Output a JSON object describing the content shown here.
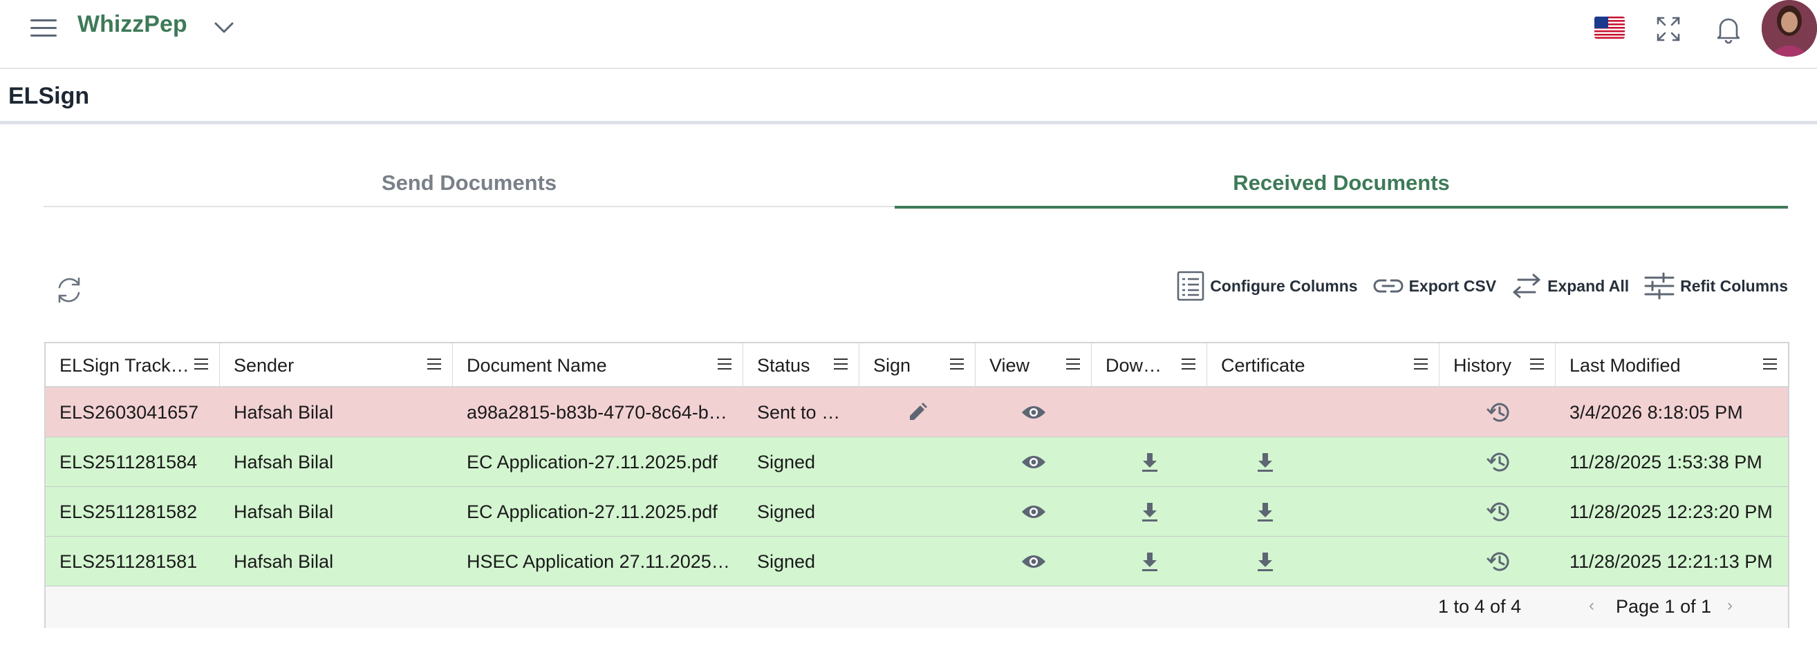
{
  "app": {
    "brand": "WhizzPep"
  },
  "page": {
    "title": "ELSign"
  },
  "tabs": [
    {
      "label": "Send Documents",
      "active": false
    },
    {
      "label": "Received Documents",
      "active": true
    }
  ],
  "toolbar": {
    "configure_columns": "Configure Columns",
    "export_csv": "Export CSV",
    "expand_all": "Expand All",
    "refit_columns": "Refit Columns"
  },
  "grid": {
    "columns": [
      "ELSign Track…",
      "Sender",
      "Document Name",
      "Status",
      "Sign",
      "View",
      "Dow…",
      "Certificate",
      "History",
      "Last Modified"
    ],
    "rows": [
      {
        "tracking": "ELS2603041657",
        "sender": "Hafsah Bilal",
        "document": "a98a2815-b83b-4770-8c64-b…",
        "status": "Sent to …",
        "last_modified": "3/4/2026 8:18:05 PM",
        "state": "pending"
      },
      {
        "tracking": "ELS2511281584",
        "sender": "Hafsah Bilal",
        "document": "EC Application-27.11.2025.pdf",
        "status": "Signed",
        "last_modified": "11/28/2025 1:53:38 PM",
        "state": "signed"
      },
      {
        "tracking": "ELS2511281582",
        "sender": "Hafsah Bilal",
        "document": "EC Application-27.11.2025.pdf",
        "status": "Signed",
        "last_modified": "11/28/2025 12:23:20 PM",
        "state": "signed"
      },
      {
        "tracking": "ELS2511281581",
        "sender": "Hafsah Bilal",
        "document": "HSEC Application 27.11.2025…",
        "status": "Signed",
        "last_modified": "11/28/2025 12:21:13 PM",
        "state": "signed"
      }
    ]
  },
  "footer": {
    "row_summary": "1 to 4 of 4",
    "page_info": "Page 1 of 1"
  },
  "colors": {
    "accent": "#3e7a58",
    "pending_row": "#f2d1d3",
    "signed_row": "#d3f5d0",
    "icon": "#5d6673"
  }
}
